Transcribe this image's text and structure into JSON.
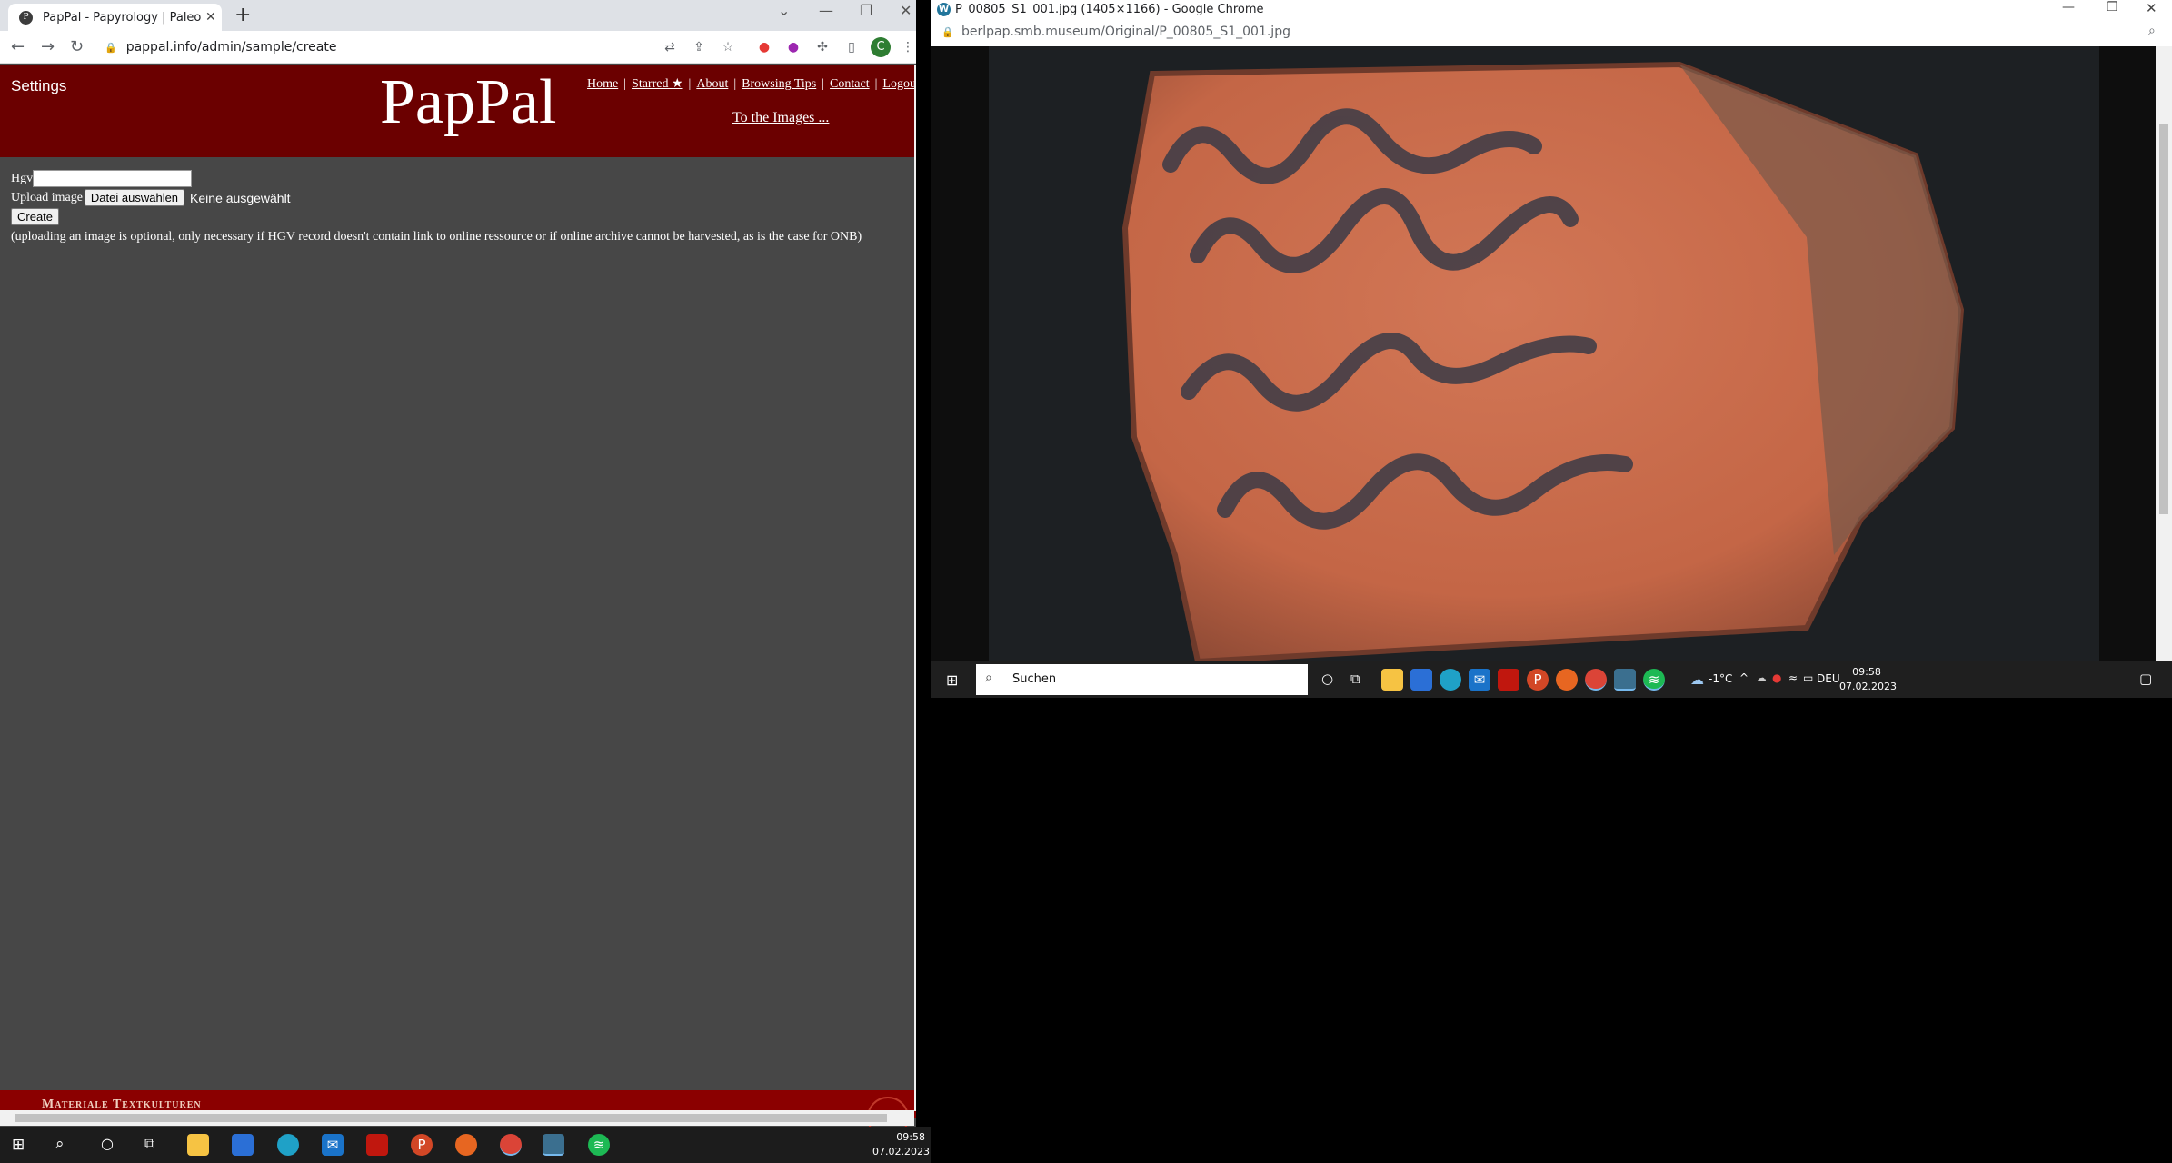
{
  "left_browser": {
    "tab_title": "PapPal - Papyrology | Paleograph",
    "url": "pappal.info/admin/sample/create",
    "profile_letter": "C"
  },
  "site": {
    "settings_label": "Settings",
    "logo": "PapPal",
    "nav": [
      "Home",
      "Starred ★",
      "About",
      "Browsing Tips",
      "Contact",
      "Logou"
    ],
    "to_images": "To the Images ..."
  },
  "form": {
    "hgv_label": "Hgv",
    "hgv_value": "",
    "upload_label": "Upload image",
    "file_button": "Datei auswählen",
    "file_status": "Keine ausgewählt",
    "create_button": "Create",
    "note": "(uploading an image is optional, only necessary if HGV record doesn't contain link to online ressource or if online archive cannot be harvested, as is the case for ONB)"
  },
  "footer": {
    "text": "Materiale Textkulturen"
  },
  "right_browser": {
    "title": "P_00805_S1_001.jpg (1405×1166) - Google Chrome",
    "url": "berlpap.smb.museum/Original/P_00805_S1_001.jpg"
  },
  "right_taskbar": {
    "search_placeholder": "Suchen",
    "weather": "-1°C",
    "language": "DEU",
    "time": "09:58",
    "date": "07.02.2023"
  },
  "taskbar": {
    "time": "09:58",
    "date": "07.02.2023"
  }
}
